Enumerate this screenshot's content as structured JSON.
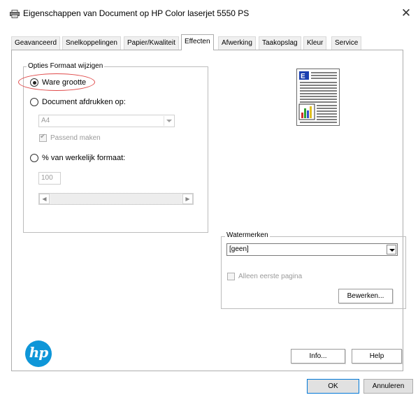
{
  "window": {
    "title": "Eigenschappen van Document op HP Color laserjet 5550 PS",
    "close_symbol": "✕",
    "icon": "printer-icon"
  },
  "tabs": [
    {
      "label": "Geavanceerd",
      "active": false
    },
    {
      "label": "Snelkoppelingen",
      "active": false
    },
    {
      "label": "Papier/Kwaliteit",
      "active": false
    },
    {
      "label": "Effecten",
      "active": true
    },
    {
      "label": "Afwerking",
      "active": false
    },
    {
      "label": "Taakopslag",
      "active": false
    },
    {
      "label": "Kleur",
      "active": false
    },
    {
      "label": "Service",
      "active": false
    }
  ],
  "resize_group": {
    "label": "Opties Formaat wijzigen",
    "options": {
      "actual_size": {
        "label": "Ware grootte",
        "checked": true
      },
      "print_on": {
        "label": "Document afdrukken op:",
        "checked": false
      },
      "percent": {
        "label": "% van werkelijk formaat:",
        "checked": false
      }
    },
    "paper_size_value": "A4",
    "fit_checkbox": {
      "label": "Passend maken",
      "checked": true,
      "disabled": true
    },
    "percent_value": "100"
  },
  "watermark_group": {
    "label": "Watermerken",
    "selected": "[geen]",
    "first_page_only": {
      "label": "Alleen eerste pagina",
      "checked": false,
      "disabled": true
    },
    "edit_button": "Bewerken..."
  },
  "buttons": {
    "info": "Info...",
    "help": "Help",
    "ok": "OK",
    "cancel": "Annuleren"
  },
  "logo": {
    "text": "hp"
  },
  "colors": {
    "highlight_ellipse": "#e04a4a",
    "hp_blue": "#0e96d8",
    "focus_blue": "#0078d7"
  }
}
